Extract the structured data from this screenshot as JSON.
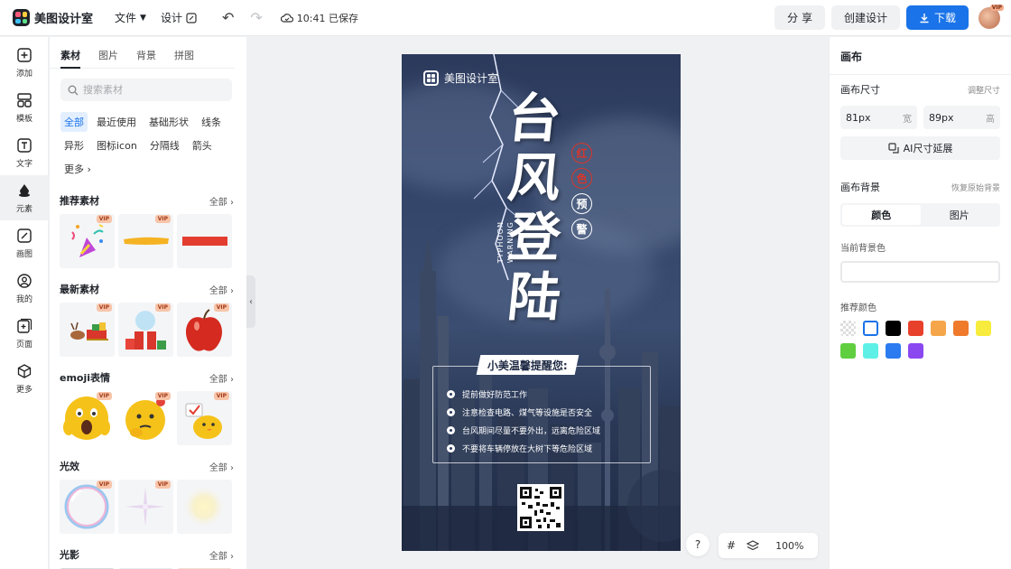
{
  "app": {
    "name": "美图设计室",
    "menu": {
      "file": "文件",
      "design": "设计"
    },
    "saved_status": "10:41 已保存",
    "share_label": "分 享",
    "create_label": "创建设计",
    "download_label": "下载",
    "avatar_badge": "VIP"
  },
  "rail": [
    {
      "label": "添加",
      "icon": "plus-square-icon"
    },
    {
      "label": "模板",
      "icon": "layout-icon"
    },
    {
      "label": "文字",
      "icon": "text-icon"
    },
    {
      "label": "元素",
      "icon": "elements-icon"
    },
    {
      "label": "画图",
      "icon": "pen-icon"
    },
    {
      "label": "我的",
      "icon": "user-icon"
    },
    {
      "label": "页面",
      "icon": "page-add-icon"
    },
    {
      "label": "更多",
      "icon": "cube-icon"
    }
  ],
  "panel": {
    "tabs": [
      "素材",
      "图片",
      "背景",
      "拼图"
    ],
    "search_placeholder": "搜索素材",
    "chips": [
      "全部",
      "最近使用",
      "基础形状",
      "线条",
      "异形",
      "图标icon",
      "分隔线",
      "箭头",
      "更多 ›"
    ],
    "sections": [
      {
        "title": "推荐素材",
        "more": "全部 ›",
        "items": [
          "party-popper",
          "yellow-brush-stroke",
          "red-bar"
        ]
      },
      {
        "title": "最新素材",
        "more": "全部 ›",
        "items": [
          "reindeer-sleigh",
          "snow-globe-gift",
          "red-apple"
        ]
      },
      {
        "title": "emoji表情",
        "more": "全部 ›",
        "items": [
          "scared-face",
          "thinking-face",
          "chick-sign"
        ]
      },
      {
        "title": "光效",
        "more": "全部 ›",
        "items": [
          "bubble-ring",
          "sparkle-cross",
          "soft-glow"
        ]
      },
      {
        "title": "光影",
        "more": "全部 ›",
        "items": []
      }
    ],
    "vip_label": "VIP"
  },
  "poster": {
    "brand": "美图设计室",
    "title_chars": [
      "台",
      "风",
      "登",
      "陆"
    ],
    "seals": [
      "红",
      "色",
      "预",
      "警"
    ],
    "english": [
      "TYPHOON",
      "WARNING"
    ],
    "reminder_title": "小美温馨提醒您:",
    "tips": [
      "提前做好防范工作",
      "注意检查电路、煤气等设施是否安全",
      "台风期间尽量不要外出，远离危险区域",
      "不要将车辆停放在大树下等危险区域"
    ]
  },
  "zoom": {
    "help": "?",
    "level": "100%"
  },
  "right_panel": {
    "title": "画布",
    "size_label": "画布尺寸",
    "size_link": "调整尺寸",
    "width_value": "81px",
    "width_unit": "宽",
    "height_value": "89px",
    "height_unit": "高",
    "ai_button": "AI尺寸延展",
    "bg_label": "画布背景",
    "bg_reset": "恢复原始背景",
    "bg_tabs": [
      "颜色",
      "图片"
    ],
    "current_bg_label": "当前背景色",
    "recommended_label": "推荐颜色",
    "colors": [
      "transparent",
      "#ffffff",
      "#000000",
      "#e8412b",
      "#f5a64a",
      "#ef7a2c",
      "#f7ec3d",
      "#5fcf3f",
      "#5ef0e6",
      "#2a7bef",
      "#8b47f0"
    ]
  }
}
